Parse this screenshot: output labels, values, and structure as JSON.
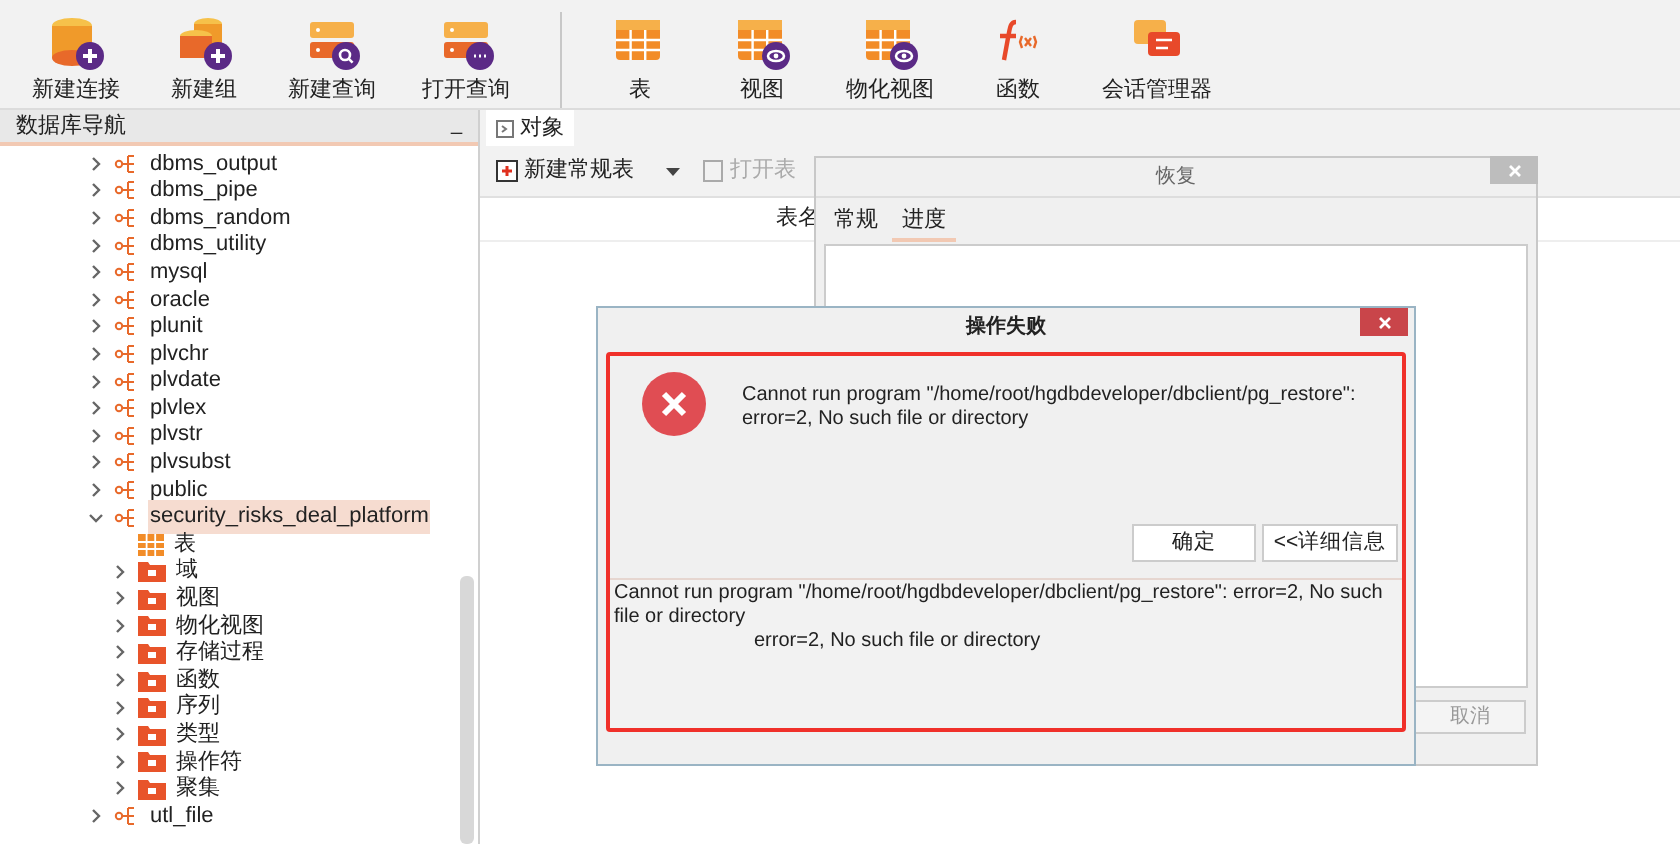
{
  "toolbar": {
    "groups": [
      [
        {
          "label": "新建连接",
          "kind": "db-add"
        },
        {
          "label": "新建组",
          "kind": "group-add"
        },
        {
          "label": "新建查询",
          "kind": "query-new"
        },
        {
          "label": "打开查询",
          "kind": "query-open"
        }
      ],
      [
        {
          "label": "表",
          "kind": "table"
        },
        {
          "label": "视图",
          "kind": "view"
        },
        {
          "label": "物化视图",
          "kind": "matview"
        },
        {
          "label": "函数",
          "kind": "function"
        },
        {
          "label": "会话管理器",
          "kind": "session"
        }
      ]
    ]
  },
  "navigator": {
    "title": "数据库导航",
    "minimize": "_",
    "tree": [
      {
        "label": "dbms_output",
        "expanded": false,
        "selected": false
      },
      {
        "label": "dbms_pipe",
        "expanded": false,
        "selected": false
      },
      {
        "label": "dbms_random",
        "expanded": false,
        "selected": false
      },
      {
        "label": "dbms_utility",
        "expanded": false,
        "selected": false
      },
      {
        "label": "mysql",
        "expanded": false,
        "selected": false
      },
      {
        "label": "oracle",
        "expanded": false,
        "selected": false
      },
      {
        "label": "plunit",
        "expanded": false,
        "selected": false
      },
      {
        "label": "plvchr",
        "expanded": false,
        "selected": false
      },
      {
        "label": "plvdate",
        "expanded": false,
        "selected": false
      },
      {
        "label": "plvlex",
        "expanded": false,
        "selected": false
      },
      {
        "label": "plvstr",
        "expanded": false,
        "selected": false
      },
      {
        "label": "plvsubst",
        "expanded": false,
        "selected": false
      },
      {
        "label": "public",
        "expanded": false,
        "selected": false
      },
      {
        "label": "security_risks_deal_platform",
        "expanded": true,
        "selected": true,
        "children": [
          {
            "label": "表",
            "kind": "table"
          },
          {
            "label": "域",
            "kind": "folder"
          },
          {
            "label": "视图",
            "kind": "folder"
          },
          {
            "label": "物化视图",
            "kind": "folder"
          },
          {
            "label": "存储过程",
            "kind": "folder"
          },
          {
            "label": "函数",
            "kind": "folder"
          },
          {
            "label": "序列",
            "kind": "folder"
          },
          {
            "label": "类型",
            "kind": "folder"
          },
          {
            "label": "操作符",
            "kind": "folder"
          },
          {
            "label": "聚集",
            "kind": "folder"
          }
        ]
      },
      {
        "label": "utl_file",
        "expanded": false,
        "selected": false
      }
    ]
  },
  "objects": {
    "tab": "对象",
    "actions": [
      {
        "label": "新建常规表",
        "disabled": false
      },
      {
        "label": "打开表",
        "disabled": true
      }
    ],
    "column_1": "表名"
  },
  "restore_dialog": {
    "title": "恢复",
    "tabs": [
      {
        "label": "常规",
        "selected": false
      },
      {
        "label": "进度",
        "selected": true
      }
    ],
    "cancel": "取消"
  },
  "error_dialog": {
    "title": "操作失败",
    "message": "Cannot run program \"/home/root/hgdbdeveloper/dbclient/pg_restore\": error=2, No such file or directory",
    "ok": "确定",
    "details_button": "<<详细信息",
    "detail_text": "Cannot run program \"/home/root/hgdbdeveloper/dbclient/pg_restore\": error=2, No such file or directory",
    "detail_trace": "error=2, No such file or directory"
  }
}
